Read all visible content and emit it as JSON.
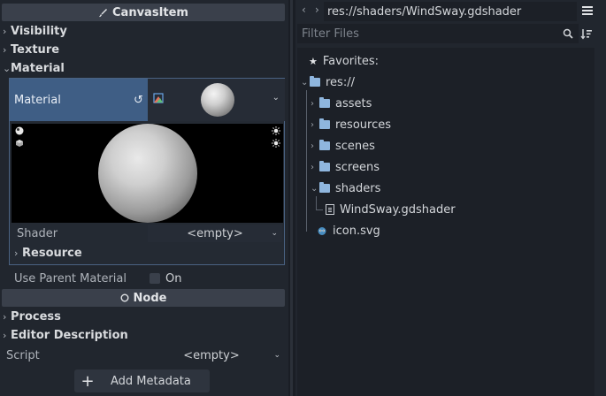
{
  "inspector": {
    "category": "CanvasItem",
    "sections": {
      "visibility": "Visibility",
      "texture": "Texture",
      "material": "Material",
      "resource": "Resource",
      "process": "Process",
      "editor_description": "Editor Description"
    },
    "material_label": "Material",
    "shader_label": "Shader",
    "shader_value": "<empty>",
    "use_parent_label": "Use Parent Material",
    "use_parent_value": "On",
    "node_category": "Node",
    "script_label": "Script",
    "script_value": "<empty>",
    "add_metadata": "Add Metadata"
  },
  "filesystem": {
    "path": "res://shaders/WindSway.gdshader",
    "filter_placeholder": "Filter Files",
    "favorites": "Favorites:",
    "root": "res://",
    "folders": [
      "assets",
      "resources",
      "scenes",
      "screens",
      "shaders"
    ],
    "shader_file": "WindSway.gdshader",
    "icon_file": "icon.svg"
  },
  "colors": {
    "accent": "#3f5e85",
    "folder": "#8fb6de",
    "background": "#21262e"
  }
}
